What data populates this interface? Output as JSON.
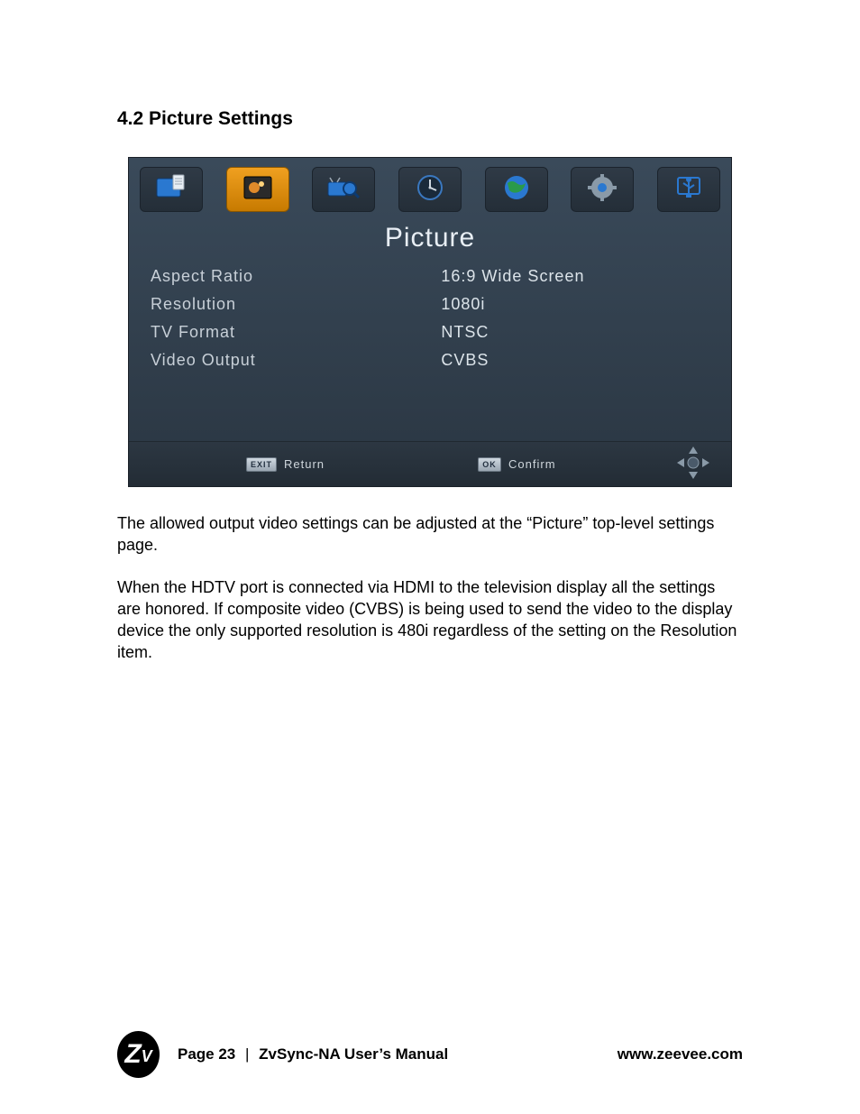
{
  "doc": {
    "section_heading": "4.2  Picture Settings",
    "paragraph1": "The allowed output video settings can be adjusted at the “Picture” top-level settings page.",
    "paragraph2": "When the HDTV port is connected via HDMI to the television display all the settings are honored.  If composite video (CVBS) is being used to send the video to the display device the only supported resolution is 480i regardless of the setting on the Resolution item."
  },
  "osd": {
    "title": "Picture",
    "rows": [
      {
        "label": "Aspect Ratio",
        "value": "16:9 Wide Screen"
      },
      {
        "label": "Resolution",
        "value": "1080i"
      },
      {
        "label": "TV Format",
        "value": "NTSC"
      },
      {
        "label": "Video Output",
        "value": "CVBS"
      }
    ],
    "footer": {
      "exit_key": "EXIT",
      "exit_label": "Return",
      "ok_key": "OK",
      "ok_label": "Confirm"
    },
    "tabs": [
      {
        "name": "program-tab",
        "icon": "program"
      },
      {
        "name": "picture-tab",
        "icon": "picture",
        "active": true
      },
      {
        "name": "search-tab",
        "icon": "search"
      },
      {
        "name": "time-tab",
        "icon": "clock"
      },
      {
        "name": "language-tab",
        "icon": "globe"
      },
      {
        "name": "system-tab",
        "icon": "gear"
      },
      {
        "name": "usb-tab",
        "icon": "usb"
      }
    ]
  },
  "footer": {
    "page_label": "Page 23",
    "separator": "|",
    "manual_title": "ZvSync-NA User’s Manual",
    "url": "www.zeevee.com",
    "logo_text_big": "Z",
    "logo_text_small": "V"
  }
}
